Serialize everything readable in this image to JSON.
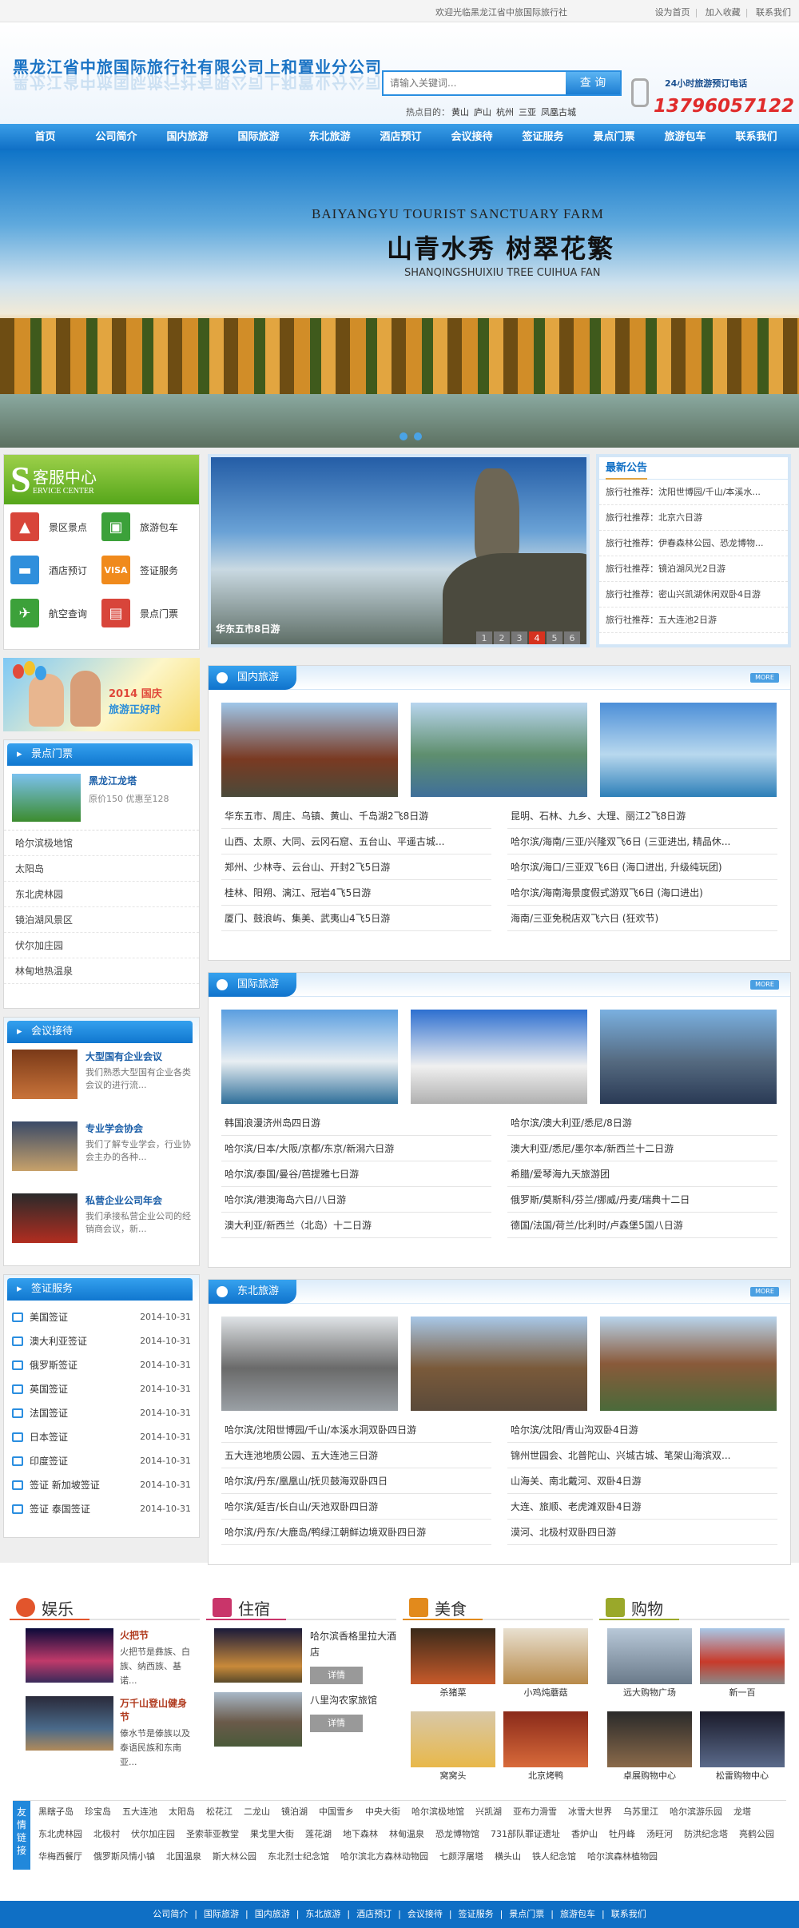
{
  "topbar": {
    "welcome": "欢迎光临黑龙江省中旅国际旅行社",
    "links": [
      "设为首页",
      "加入收藏",
      "联系我们"
    ]
  },
  "header": {
    "company": "黑龙江省中旅国际旅行社有限公司上和置业分公司",
    "search_placeholder": "请输入关键词...",
    "search_button": "查 询",
    "hot_label": "热点目的：",
    "hot_items": [
      "黄山",
      "庐山",
      "杭州",
      "三亚",
      "凤凰古城"
    ],
    "hotline_label": "24小时旅游预订电话",
    "hotline": "13796057122"
  },
  "nav": [
    "首页",
    "公司简介",
    "国内旅游",
    "国际旅游",
    "东北旅游",
    "酒店预订",
    "会议接待",
    "签证服务",
    "景点门票",
    "旅游包车",
    "联系我们"
  ],
  "banner": {
    "en": "BAIYANGYU TOURIST SANCTUARY FARM",
    "cn": "山青水秀 树翠花繁",
    "pinyin": "SHANQINGSHUIXIU TREE CUIHUA FAN"
  },
  "service": {
    "cn": "客服中心",
    "en": "ERVICE CENTER",
    "big": "S",
    "items": [
      "景区景点",
      "旅游包车",
      "酒店预订",
      "签证服务",
      "航空查询",
      "景点门票"
    ],
    "colors": [
      "#d8453a",
      "#3ca13a",
      "#2f8fdc",
      "#f08a1c",
      "#3ca13a",
      "#d8453a"
    ]
  },
  "promo": {
    "line1": "2014 国庆",
    "line2": "旅游正好时"
  },
  "scenic": {
    "title": "景点门票",
    "feat_name": "黑龙江龙塔",
    "feat_price": "原价150 优惠至128",
    "list": [
      "哈尔滨极地馆",
      "太阳岛",
      "东北虎林园",
      "镜泊湖风景区",
      "伏尔加庄园",
      "林甸地热温泉"
    ]
  },
  "meeting": {
    "title": "会议接待",
    "items": [
      {
        "name": "大型国有企业会议",
        "desc": "我们熟悉大型国有企业各类会议的进行流..."
      },
      {
        "name": "专业学会协会",
        "desc": "我们了解专业学会，行业协会主办的各种..."
      },
      {
        "name": "私营企业公司年会",
        "desc": "我们承接私营企业公司的经销商会议，新..."
      }
    ]
  },
  "visa": {
    "title": "签证服务",
    "items": [
      {
        "name": "美国签证",
        "date": "2014-10-31"
      },
      {
        "name": "澳大利亚签证",
        "date": "2014-10-31"
      },
      {
        "name": "俄罗斯签证",
        "date": "2014-10-31"
      },
      {
        "name": "英国签证",
        "date": "2014-10-31"
      },
      {
        "name": "法国签证",
        "date": "2014-10-31"
      },
      {
        "name": "日本签证",
        "date": "2014-10-31"
      },
      {
        "name": "印度签证",
        "date": "2014-10-31"
      },
      {
        "name": "签证 新加坡签证",
        "date": "2014-10-31"
      },
      {
        "name": "签证 泰国签证",
        "date": "2014-10-31"
      }
    ]
  },
  "slide": {
    "caption": "华东五市8日游",
    "pages": [
      "1",
      "2",
      "3",
      "4",
      "5",
      "6"
    ],
    "active": 4
  },
  "notice": {
    "title": "最新公告",
    "items": [
      "旅行社推荐：沈阳世博园/千山/本溪水...",
      "旅行社推荐：北京六日游",
      "旅行社推荐：伊春森林公园、恐龙博物...",
      "旅行社推荐：镜泊湖风光2日游",
      "旅行社推荐：密山兴凯湖休闲双卧4日游",
      "旅行社推荐：五大连池2日游"
    ]
  },
  "domestic": {
    "title": "国内旅游",
    "more": "MORE",
    "routes": [
      "华东五市、周庄、乌镇、黄山、千岛湖2飞8日游",
      "昆明、石林、九乡、大理、丽江2飞8日游",
      "山西、太原、大同、云冈石窟、五台山、平遥古城...",
      "哈尔滨/海南/三亚/兴隆双飞6日 (三亚进出, 精品休...",
      "郑州、少林寺、云台山、开封2飞5日游",
      "哈尔滨/海口/三亚双飞6日 (海口进出, 升级纯玩团)",
      "桂林、阳朔、漓江、冠岩4飞5日游",
      "哈尔滨/海南海景度假式游双飞6日 (海口进出)",
      "厦门、鼓浪屿、集美、武夷山4飞5日游",
      "海南/三亚免税店双飞六日 (狂欢节)"
    ]
  },
  "international": {
    "title": "国际旅游",
    "more": "MORE",
    "routes": [
      "韩国浪漫济州岛四日游",
      "哈尔滨/澳大利亚/悉尼/8日游",
      "哈尔滨/日本/大阪/京都/东京/新潟六日游",
      "澳大利亚/悉尼/墨尔本/新西兰十二日游",
      "哈尔滨/泰国/曼谷/芭提雅七日游",
      "希腊/爱琴海九天旅游团",
      "哈尔滨/港澳海岛六日/八日游",
      "俄罗斯/莫斯科/芬兰/挪威/丹麦/瑞典十二日",
      "澳大利亚/新西兰（北岛）十二日游",
      "德国/法国/荷兰/比利时/卢森堡5国八日游"
    ]
  },
  "northeast": {
    "title": "东北旅游",
    "more": "MORE",
    "routes": [
      "哈尔滨/沈阳世博园/千山/本溪水洞双卧四日游",
      "哈尔滨/沈阳/青山沟双卧4日游",
      "五大连池地质公园、五大连池三日游",
      "锦州世园会、北普陀山、兴城古城、笔架山海滨双...",
      "哈尔滨/丹东/凰凰山/抚贝鼓海双卧四日",
      "山海关、南北戴河、双卧4日游",
      "哈尔滨/延吉/长白山/天池双卧四日游",
      "大连、旅顺、老虎滩双卧4日游",
      "哈尔滨/丹东/大鹿岛/鸭绿江朝鲜边境双卧四日游",
      "漠河、北极村双卧四日游"
    ]
  },
  "entertainment": {
    "title": "娱乐",
    "items": [
      {
        "name": "火把节",
        "desc": "火把节是彝族、白族、纳西族、基诺..."
      },
      {
        "name": "万千山登山健身节",
        "desc": "傣水节是傣族以及泰语民族和东南亚..."
      }
    ]
  },
  "lodging": {
    "title": "住宿",
    "items": [
      {
        "name": "哈尔滨香格里拉大酒店",
        "btn": "详情"
      },
      {
        "name": "八里沟农家旅馆",
        "btn": "详情"
      }
    ]
  },
  "food": {
    "title": "美食",
    "items": [
      "杀猪菜",
      "小鸡炖蘑菇",
      "窝窝头",
      "北京烤鸭"
    ]
  },
  "shopping": {
    "title": "购物",
    "items": [
      "远大购物广场",
      "新一百",
      "卓展购物中心",
      "松雷购物中心"
    ]
  },
  "friends": {
    "label": "友情链接",
    "links": [
      "黑瞎子岛",
      "珍宝岛",
      "五大连池",
      "太阳岛",
      "松花江",
      "二龙山",
      "镜泊湖",
      "中国雪乡",
      "中央大街",
      "哈尔滨极地馆",
      "兴凯湖",
      "亚布力滑雪",
      "冰雪大世界",
      "乌苏里江",
      "哈尔滨游乐园",
      "龙塔",
      "东北虎林园",
      "北极村",
      "伏尔加庄园",
      "圣索菲亚教堂",
      "果戈里大街",
      "莲花湖",
      "地下森林",
      "林甸温泉",
      "恐龙博物馆",
      "731部队罪证遗址",
      "香炉山",
      "牡丹峰",
      "汤旺河",
      "防洪纪念塔",
      "亮鹤公园",
      "华梅西餐厅",
      "俄罗斯风情小镇",
      "北国温泉",
      "斯大林公园",
      "东北烈士纪念馆",
      "哈尔滨北方森林动物园",
      "七颜浮屠塔",
      "横头山",
      "铁人纪念馆",
      "哈尔滨森林植物园"
    ]
  },
  "footer": [
    "公司简介",
    "国际旅游",
    "国内旅游",
    "东北旅游",
    "酒店预订",
    "会议接待",
    "签证服务",
    "景点门票",
    "旅游包车",
    "联系我们"
  ]
}
